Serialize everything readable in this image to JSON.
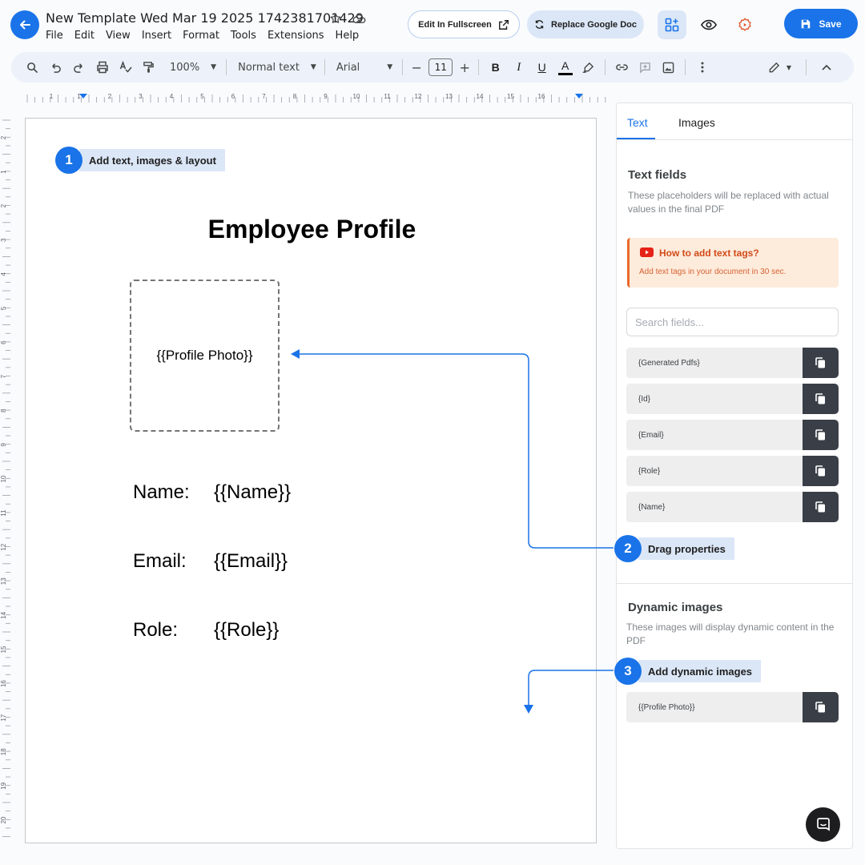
{
  "header": {
    "title": "New Template Wed Mar 19 2025 1742381701429",
    "menu": [
      "File",
      "Edit",
      "View",
      "Insert",
      "Format",
      "Tools",
      "Extensions",
      "Help"
    ],
    "edit_fullscreen_label": "Edit In Fullscreen",
    "replace_doc_label": "Replace Google Doc",
    "save_label": "Save",
    "icons": [
      "back-arrow-icon",
      "star-icon",
      "cloud-icon",
      "external-link-icon",
      "refresh-icon",
      "add-widget-icon",
      "eye-icon",
      "gear-icon",
      "save-disk-icon"
    ]
  },
  "toolbar": {
    "zoom": "100%",
    "style": "Normal text",
    "font": "Arial",
    "font_size": "11",
    "bold": "B",
    "italic": "I",
    "underline": "U",
    "text_color_glyph": "A",
    "minus": "−",
    "plus": "+"
  },
  "ruler": {
    "horizontal_labels": [
      "1",
      "1",
      "2",
      "3",
      "4",
      "5",
      "6",
      "7",
      "8",
      "9",
      "10",
      "11",
      "12",
      "13",
      "14",
      "15",
      "16"
    ],
    "vertical_labels": [
      "2",
      "1",
      "2",
      "3",
      "4",
      "5",
      "6",
      "7",
      "8",
      "9",
      "10",
      "11",
      "12",
      "13",
      "14",
      "15",
      "16",
      "17",
      "18",
      "19",
      "20",
      "21"
    ]
  },
  "document": {
    "step1": {
      "number": "1",
      "label": "Add text, images & layout"
    },
    "heading": "Employee Profile",
    "photo_placeholder": "{{Profile Photo}}",
    "fields": [
      {
        "label": "Name:",
        "value": "{{Name}}"
      },
      {
        "label": "Email:",
        "value": "{{Email}}"
      },
      {
        "label": "Role:",
        "value": "{{Role}}"
      }
    ]
  },
  "panel": {
    "tabs": [
      "Text",
      "Images"
    ],
    "active_tab": "Text",
    "text_fields_title": "Text fields",
    "text_fields_desc": "These placeholders will be replaced with actual values in the final PDF",
    "help_title": "How to add text tags?",
    "help_desc": "Add text tags in your document in 30 sec.",
    "search_placeholder": "Search fields...",
    "text_fields": [
      "{Generated Pdfs}",
      "{Id}",
      "{Email}",
      "{Role}",
      "{Name}"
    ],
    "step2": {
      "number": "2",
      "label": "Drag properties"
    },
    "dynamic_images_title": "Dynamic images",
    "dynamic_images_desc": "These images will display dynamic content in the PDF",
    "step3": {
      "number": "3",
      "label": "Add dynamic images"
    },
    "image_fields": [
      "{{Profile Photo}}"
    ]
  },
  "colors": {
    "accent": "#1a73e8",
    "accent_light": "#dbe7f7",
    "help_bg": "#fdebdc",
    "help_text": "#d24a17",
    "copy_button": "#3a3f47"
  }
}
